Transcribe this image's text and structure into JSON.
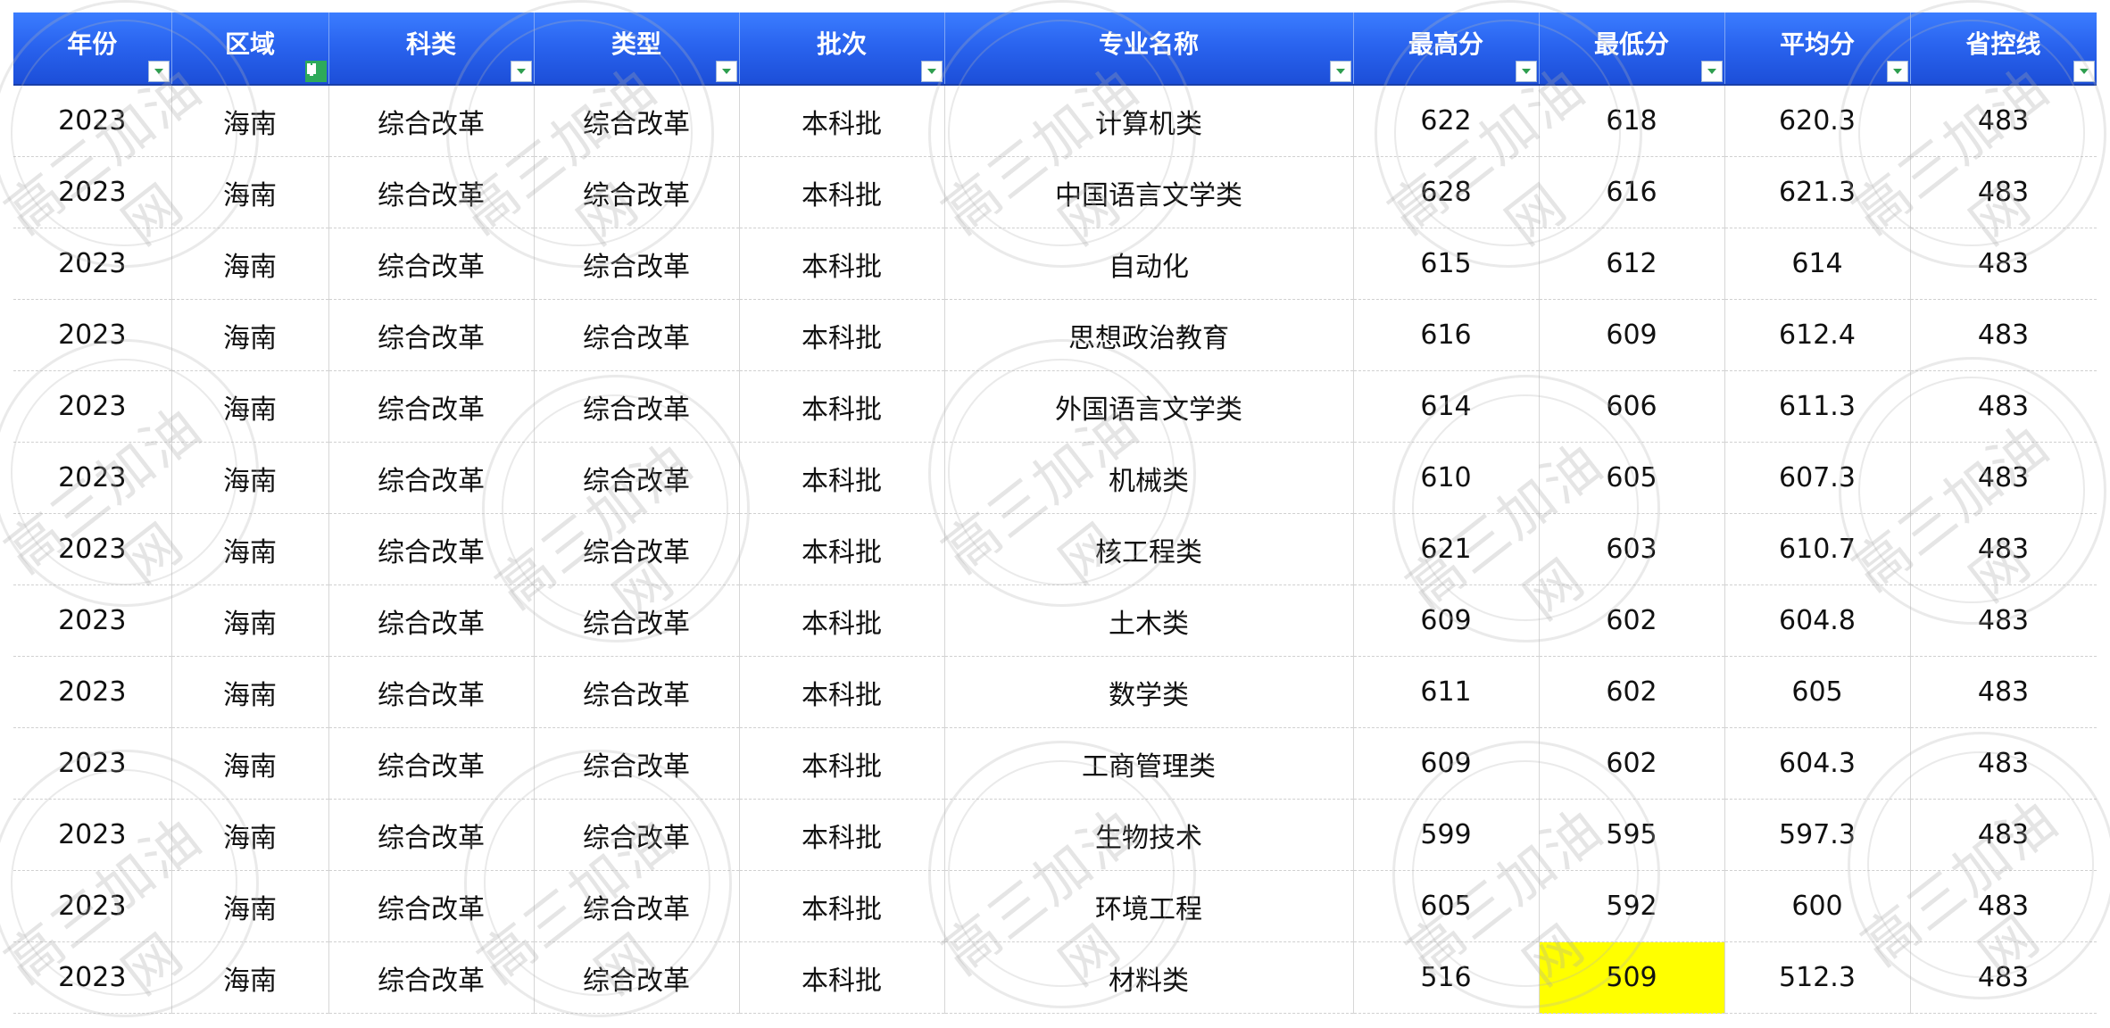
{
  "columns": [
    {
      "label": "年份",
      "filter_active": false
    },
    {
      "label": "区域",
      "filter_active": true
    },
    {
      "label": "科类",
      "filter_active": false
    },
    {
      "label": "类型",
      "filter_active": false
    },
    {
      "label": "批次",
      "filter_active": false
    },
    {
      "label": "专业名称",
      "filter_active": false
    },
    {
      "label": "最高分",
      "filter_active": false
    },
    {
      "label": "最低分",
      "filter_active": false
    },
    {
      "label": "平均分",
      "filter_active": false
    },
    {
      "label": "省控线",
      "filter_active": false
    }
  ],
  "rows": [
    [
      "2023",
      "海南",
      "综合改革",
      "综合改革",
      "本科批",
      "计算机类",
      "622",
      "618",
      "620.3",
      "483"
    ],
    [
      "2023",
      "海南",
      "综合改革",
      "综合改革",
      "本科批",
      "中国语言文学类",
      "628",
      "616",
      "621.3",
      "483"
    ],
    [
      "2023",
      "海南",
      "综合改革",
      "综合改革",
      "本科批",
      "自动化",
      "615",
      "612",
      "614",
      "483"
    ],
    [
      "2023",
      "海南",
      "综合改革",
      "综合改革",
      "本科批",
      "思想政治教育",
      "616",
      "609",
      "612.4",
      "483"
    ],
    [
      "2023",
      "海南",
      "综合改革",
      "综合改革",
      "本科批",
      "外国语言文学类",
      "614",
      "606",
      "611.3",
      "483"
    ],
    [
      "2023",
      "海南",
      "综合改革",
      "综合改革",
      "本科批",
      "机械类",
      "610",
      "605",
      "607.3",
      "483"
    ],
    [
      "2023",
      "海南",
      "综合改革",
      "综合改革",
      "本科批",
      "核工程类",
      "621",
      "603",
      "610.7",
      "483"
    ],
    [
      "2023",
      "海南",
      "综合改革",
      "综合改革",
      "本科批",
      "土木类",
      "609",
      "602",
      "604.8",
      "483"
    ],
    [
      "2023",
      "海南",
      "综合改革",
      "综合改革",
      "本科批",
      "数学类",
      "611",
      "602",
      "605",
      "483"
    ],
    [
      "2023",
      "海南",
      "综合改革",
      "综合改革",
      "本科批",
      "工商管理类",
      "609",
      "602",
      "604.3",
      "483"
    ],
    [
      "2023",
      "海南",
      "综合改革",
      "综合改革",
      "本科批",
      "生物技术",
      "599",
      "595",
      "597.3",
      "483"
    ],
    [
      "2023",
      "海南",
      "综合改革",
      "综合改革",
      "本科批",
      "环境工程",
      "605",
      "592",
      "600",
      "483"
    ],
    [
      "2023",
      "海南",
      "综合改革",
      "综合改革",
      "本科批",
      "材料类",
      "516",
      "509",
      "512.3",
      "483"
    ]
  ],
  "highlighted_cell": {
    "row": 12,
    "col": 7,
    "color": "#ffff00"
  },
  "colors": {
    "header_background": "#2a64ef",
    "header_text": "#ffffff",
    "filter_active": "#2eaa5a",
    "highlight": "#ffff00"
  },
  "watermark": {
    "text": "高三加油网"
  }
}
